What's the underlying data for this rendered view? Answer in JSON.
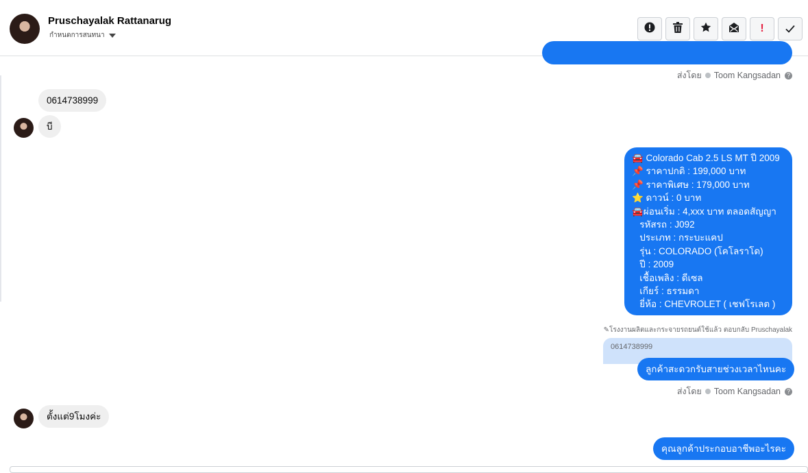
{
  "header": {
    "contact_name": "Pruschayalak Rattanarug",
    "conversation_action": "กำหนดการสนทนา",
    "toolbar": [
      {
        "icon": "alert-circle-icon",
        "glyph": "❗"
      },
      {
        "icon": "trash-icon",
        "glyph": "🗑"
      },
      {
        "icon": "star-icon",
        "glyph": "★"
      },
      {
        "icon": "mark-unread-icon",
        "glyph": "✉"
      },
      {
        "icon": "important-icon",
        "glyph": "!"
      },
      {
        "icon": "check-icon",
        "glyph": "✓"
      }
    ]
  },
  "messages": {
    "sent_by_label": "ส่งโดย",
    "agent_name": "Toom Kangsadan",
    "help_glyph": "?",
    "incoming_1": "0614738999",
    "incoming_2": "บี",
    "car_listing": [
      "🚘 Colorado Cab 2.5 LS MT ปี 2009",
      "📌 ราคาปกติ : 199,000 บาท",
      "📌 ราคาพิเศษ : 179,000 บาท",
      "⭐ ดาวน์ : 0 บาท",
      "🚘ผ่อนเริ่ม : 4,xxx บาท ตลอดสัญญา",
      "   รหัสรถ : J092",
      "   ประเภท : กระบะแคป",
      "   รุ่น : COLORADO (โคโลราโด)",
      "   ปี : 2009",
      "   เชื้อเพลิง : ดีเซล",
      "   เกียร์ : ธรรมดา",
      "   ยี่ห้อ : CHEVROLET ( เชฟโรเลต )"
    ],
    "reply_note": "โรงงานผลิตและกระจายรถยนต์ใช้แล้ว ตอบกลับ Pruschayalak",
    "quoted_text": "0614738999",
    "outgoing_question": "ลูกค้าสะดวกรับสายช่วงเวลาไหนคะ",
    "incoming_3": "ตั้งแต่9โมงค่ะ",
    "outgoing_last": "คุณลูกค้าประกอบอาชีพอะไรคะ"
  },
  "colors": {
    "outgoing_bubble": "#1877f2",
    "incoming_bubble": "#efefef",
    "quoted_bubble": "#cfe2fb"
  }
}
